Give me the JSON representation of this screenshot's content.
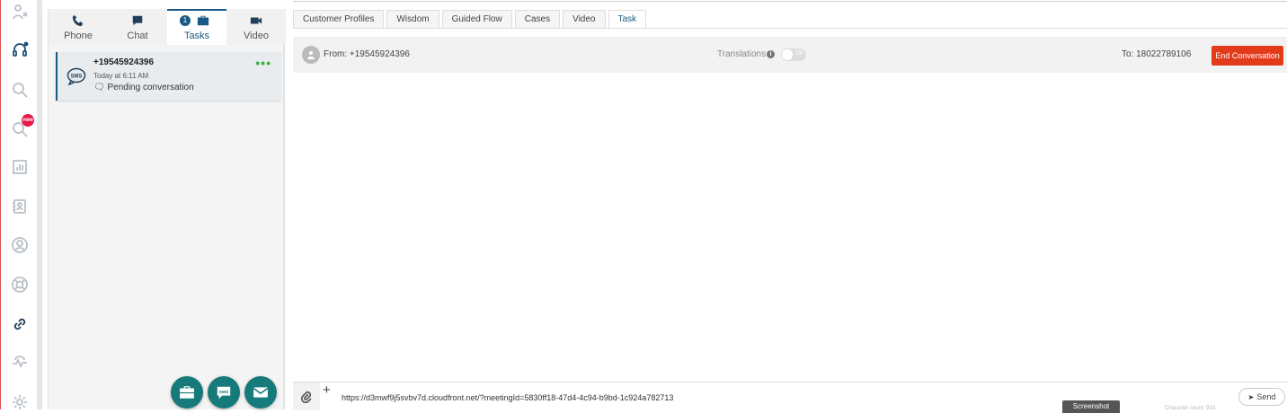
{
  "rail": {
    "items": [
      {
        "icon": "agent-icon"
      },
      {
        "icon": "headset-icon"
      },
      {
        "icon": "search-icon"
      },
      {
        "icon": "search-new-icon",
        "badge": "new"
      },
      {
        "icon": "reports-icon"
      },
      {
        "icon": "contacts-icon"
      },
      {
        "icon": "user-icon"
      },
      {
        "icon": "support-icon"
      },
      {
        "icon": "link-icon"
      },
      {
        "icon": "activity-icon"
      },
      {
        "icon": "settings-icon"
      }
    ]
  },
  "channels": {
    "tabs": [
      {
        "label": "Phone",
        "icon": "phone-icon"
      },
      {
        "label": "Chat",
        "icon": "chat-icon"
      },
      {
        "label": "Tasks",
        "icon": "briefcase-icon",
        "count": "1",
        "active": true
      },
      {
        "label": "Video",
        "icon": "video-icon"
      }
    ],
    "task": {
      "number": "+19545924396",
      "time": "Today at 6:11 AM",
      "status": "Pending conversation",
      "icon": "sms-bubble-icon"
    },
    "fabs": [
      "briefcase-icon",
      "sms-icon",
      "email-icon"
    ]
  },
  "content_tabs": [
    "Customer Profiles",
    "Wisdom",
    "Guided Flow",
    "Cases",
    "Video",
    "Task"
  ],
  "active_content_tab": "Task",
  "conversation": {
    "from": "From: +19545924396",
    "translations_label": "Translations",
    "translations_state": "Off",
    "to": "To: 18022789106",
    "end_button": "End Conversation"
  },
  "composer": {
    "plus": "+",
    "message": "https://d3mwf9j5svbv7d.cloudfront.net/?meetingId=5830ff18-47d4-4c94-b9bd-1c924a782713",
    "tooltip": "Screenshot",
    "char_count": "Character count: 933",
    "send_label": "Send"
  },
  "colors": {
    "brand": "#1a5a86",
    "end_button": "#e23b1c",
    "fab": "#167a7a",
    "badge_new": "#e8194a"
  }
}
